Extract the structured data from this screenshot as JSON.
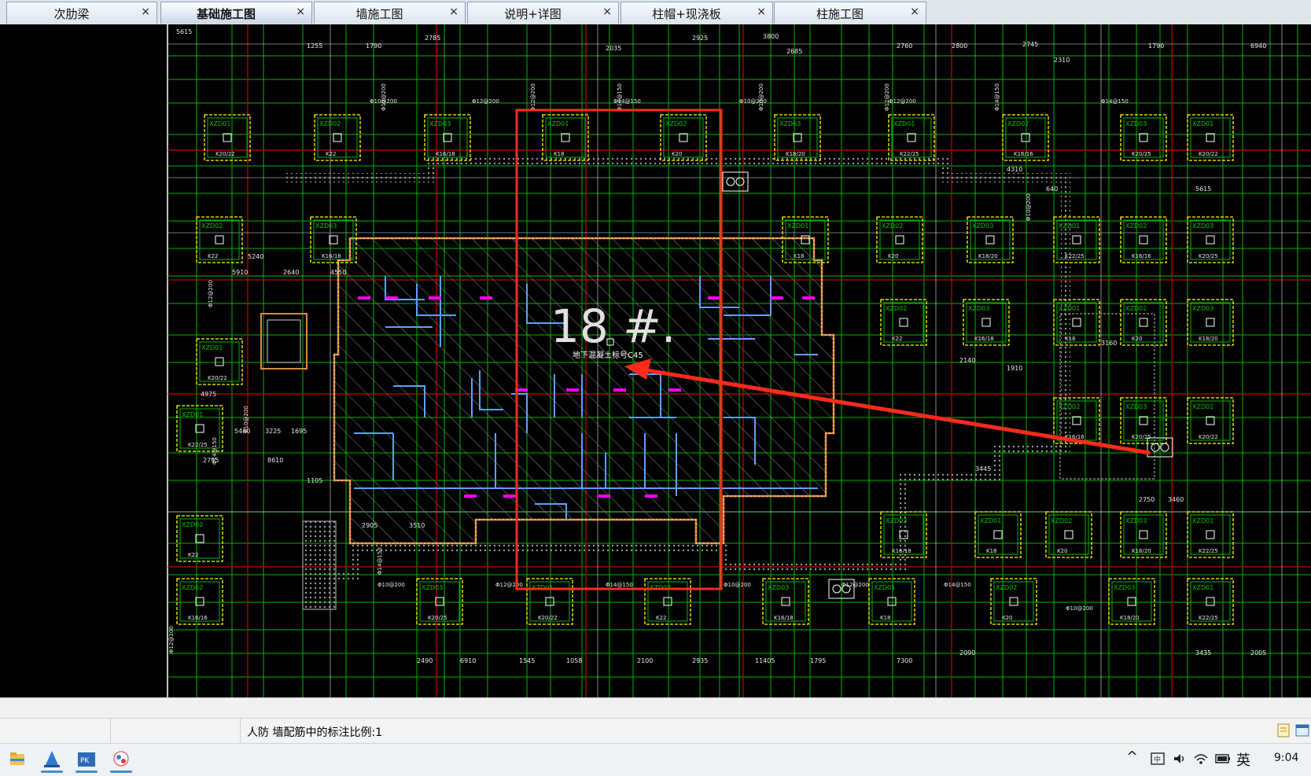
{
  "tabs": [
    {
      "label": "次肋梁",
      "close": "×",
      "active": false
    },
    {
      "label": "基础施工图",
      "close": "×",
      "active": true
    },
    {
      "label": "墙施工图",
      "close": "×",
      "active": false
    },
    {
      "label": "说明+详图",
      "close": "×",
      "active": false
    },
    {
      "label": "柱帽+现浇板",
      "close": "×",
      "active": false
    },
    {
      "label": "柱施工图",
      "close": "×",
      "active": false
    }
  ],
  "drawing": {
    "building_label": "18 #.",
    "concrete_note": "地下混凝土标号C45",
    "column_tags": [
      "XZD01",
      "XZD02",
      "XZD03"
    ],
    "rebar_labels": [
      "K20/22",
      "K22",
      "K16/18",
      "K18",
      "K20",
      "K18/20",
      "K22/25",
      "K16/16",
      "K20/25"
    ],
    "dimensions": [
      "5615",
      "2785",
      "1255",
      "1790",
      "2925",
      "3800",
      "2685",
      "2035",
      "2760",
      "2800",
      "2745",
      "2310",
      "1790",
      "6940",
      "5240",
      "5910",
      "2640",
      "4550",
      "4975",
      "5460",
      "3225",
      "1695",
      "2795",
      "8610",
      "1105",
      "2905",
      "3510",
      "2140",
      "3445",
      "1910",
      "3160",
      "2750",
      "3460",
      "2090",
      "3435",
      "2005",
      "2490",
      "6910",
      "1545",
      "1058",
      "2100",
      "2935",
      "11405",
      "1795",
      "7300",
      "4310",
      "640"
    ],
    "spacing_labels": [
      "Φ10@200",
      "Φ12@200",
      "Φ14@150"
    ],
    "colors": {
      "background": "#000000",
      "grid_green": "#00c800",
      "dim_white": "#e8e8e8",
      "column_yellow": "#ffff00",
      "wall_orange": "#d98a3a",
      "wall_blue": "#5fa0ff",
      "highlight_red": "#ff2a1a",
      "magenta": "#ff00ff",
      "dark_red": "#c80000"
    }
  },
  "status": {
    "message": "人防  墙配筋中的标注比例:1"
  },
  "taskbar": {
    "apps": [
      {
        "icon": "file-explorer-icon"
      },
      {
        "icon": "cad-app-icon"
      },
      {
        "icon": "structure-app-icon"
      },
      {
        "icon": "chat-app-icon"
      }
    ],
    "ime": "英",
    "time": "9:04"
  }
}
